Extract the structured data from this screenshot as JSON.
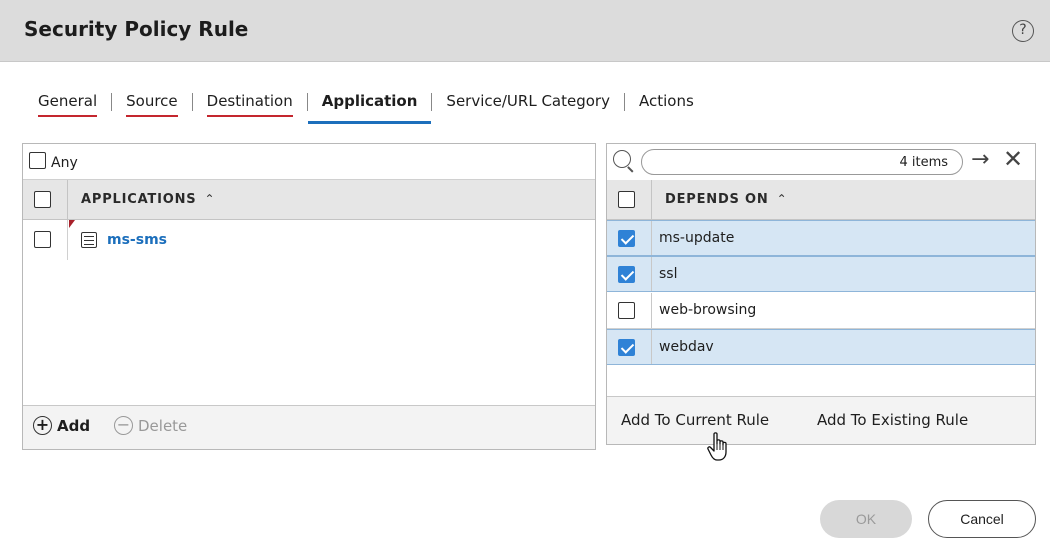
{
  "dialog": {
    "title": "Security Policy Rule",
    "help_glyph": "?"
  },
  "tabs": [
    {
      "label": "General",
      "active": false
    },
    {
      "label": "Source",
      "active": false
    },
    {
      "label": "Destination",
      "active": false
    },
    {
      "label": "Application",
      "active": true
    },
    {
      "label": "Service/URL Category",
      "active": false
    },
    {
      "label": "Actions",
      "active": false
    }
  ],
  "applications_panel": {
    "any_label": "Any",
    "any_checked": false,
    "column_header": "APPLICATIONS",
    "sort_glyph": "^",
    "rows": [
      {
        "name": "ms-sms",
        "checked": false
      }
    ],
    "add_label": "Add",
    "delete_label": "Delete"
  },
  "depends_panel": {
    "search": {
      "value": "4 items",
      "placeholder": ""
    },
    "arrow_glyph": "→",
    "close_glyph": "✕",
    "column_header": "DEPENDS ON",
    "sort_glyph": "^",
    "rows": [
      {
        "name": "ms-update",
        "checked": true
      },
      {
        "name": "ssl",
        "checked": true
      },
      {
        "name": "web-browsing",
        "checked": false
      },
      {
        "name": "webdav",
        "checked": true
      }
    ],
    "add_current_label": "Add To Current Rule",
    "add_existing_label": "Add To Existing Rule"
  },
  "buttons": {
    "ok_label": "OK",
    "ok_disabled": true,
    "cancel_label": "Cancel"
  },
  "colors": {
    "accent_blue": "#1c6fbc",
    "checkbox_blue": "#2f82d6",
    "tab_underline_red": "#c4262e",
    "selected_row": "#d6e6f4"
  }
}
